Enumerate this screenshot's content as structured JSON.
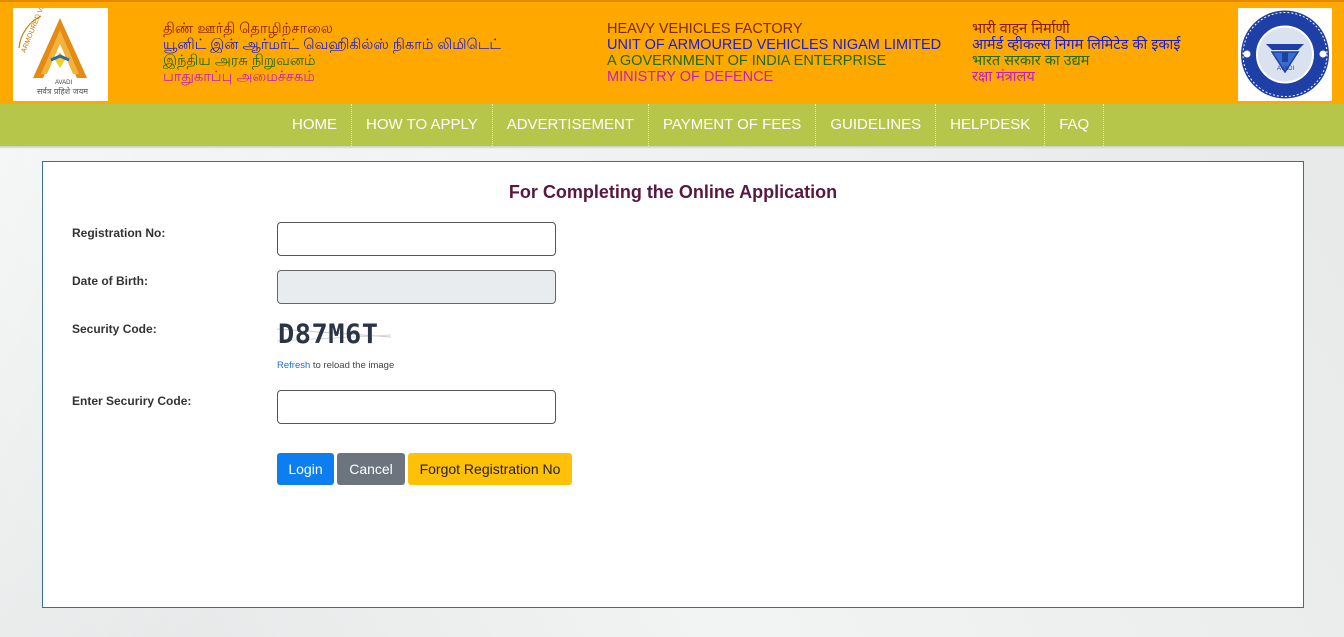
{
  "header": {
    "tamil": [
      "திண் ஊர்தி தொழிற்சாலை",
      "யூனிட் இன் ஆர்மர்ட் வெஹிகில்ஸ் நிகாம் லிமிடெட்",
      "இந்திய அரசு நிறுவனம்",
      "பாதுகாப்பு அமைச்சகம்"
    ],
    "english": [
      "HEAVY VEHICLES FACTORY",
      "UNIT OF ARMOURED VEHICLES NIGAM LIMITED",
      "A GOVERNMENT OF INDIA ENTERPRISE",
      "MINISTRY OF DEFENCE"
    ],
    "hindi": [
      "भारी वाहन निर्माणी",
      "आर्मर्ड व्हीकल्स निगम लिमिटेड की इकाई",
      "भारत सरकार का उद्यम",
      "रक्षा मंत्रालय"
    ],
    "logo_left": {
      "icon": "armoured-vehicles-emblem",
      "text_top": "ARMOURED VEHICLES",
      "text_avadi": "AVADI",
      "text_motto": "सर्वत्र प्रहिशे जयम"
    },
    "logo_right": {
      "icon": "hvf-avadi-emblem",
      "text_center": "AVADI"
    },
    "colors": {
      "background": "#ffa800"
    }
  },
  "nav": {
    "items": [
      "HOME",
      "HOW TO APPLY",
      "ADVERTISEMENT",
      "PAYMENT OF FEES",
      "GUIDELINES",
      "HELPDESK",
      "FAQ"
    ],
    "colors": {
      "background": "#b5c64a"
    }
  },
  "form": {
    "title": "For Completing the Online Application",
    "registration_label": "Registration No:",
    "registration_value": "",
    "dob_label": "Date of Birth:",
    "dob_value": "",
    "security_label": "Security Code:",
    "captcha_text": "D87M6T",
    "refresh_link": "Refresh",
    "refresh_rest": " to reload the image",
    "enter_security_label": "Enter Securiry Code:",
    "enter_security_value": "",
    "login_label": "Login",
    "cancel_label": "Cancel",
    "forgot_label": "Forgot Registration No"
  }
}
